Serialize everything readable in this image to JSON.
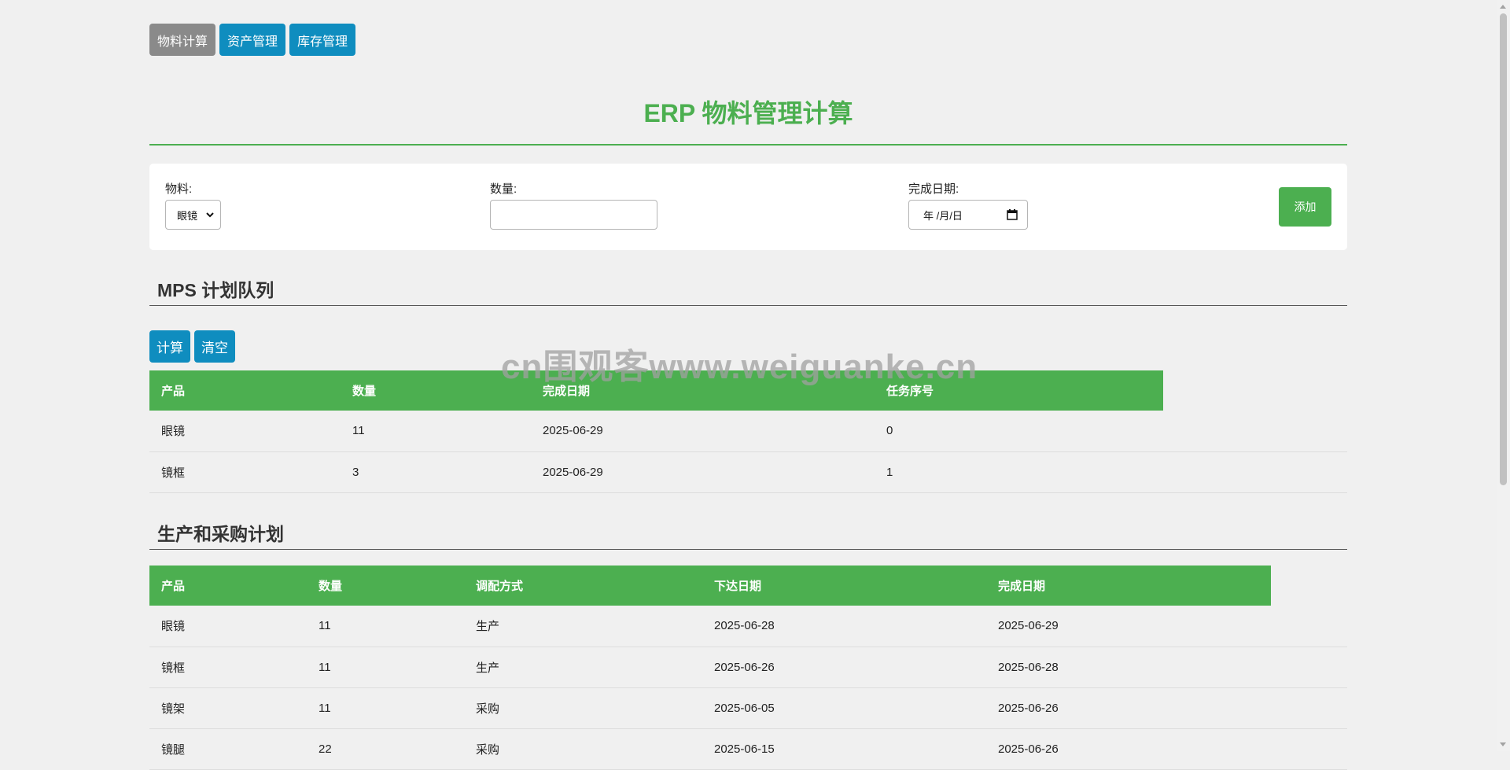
{
  "nav": {
    "tabs": [
      {
        "label": "物料计算",
        "active": true
      },
      {
        "label": "资产管理",
        "active": false
      },
      {
        "label": "库存管理",
        "active": false
      }
    ]
  },
  "page_title": "ERP 物料管理计算",
  "form": {
    "material_label": "物料:",
    "material_value": "眼镜",
    "quantity_label": "数量:",
    "quantity_value": "",
    "date_label": "完成日期:",
    "date_placeholder": "年 /月/日",
    "add_button": "添加"
  },
  "mps": {
    "title": "MPS 计划队列",
    "buttons": {
      "calculate": "计算",
      "clear": "清空"
    },
    "columns": [
      "产品",
      "数量",
      "完成日期",
      "任务序号"
    ],
    "rows": [
      [
        "眼镜",
        "11",
        "2025-06-29",
        "0"
      ],
      [
        "镜框",
        "3",
        "2025-06-29",
        "1"
      ]
    ]
  },
  "plan": {
    "title": "生产和采购计划",
    "columns": [
      "产品",
      "数量",
      "调配方式",
      "下达日期",
      "完成日期"
    ],
    "rows": [
      [
        "眼镜",
        "11",
        "生产",
        "2025-06-28",
        "2025-06-29"
      ],
      [
        "镜框",
        "11",
        "生产",
        "2025-06-26",
        "2025-06-28"
      ],
      [
        "镜架",
        "11",
        "采购",
        "2025-06-05",
        "2025-06-26"
      ],
      [
        "镜腿",
        "22",
        "采购",
        "2025-06-15",
        "2025-06-26"
      ]
    ]
  },
  "watermark": "cn围观客www.weiguanke.cn",
  "colors": {
    "accent_green": "#4caf50",
    "button_blue": "#0f8dbf",
    "active_tab_gray": "#8a8a8a"
  }
}
